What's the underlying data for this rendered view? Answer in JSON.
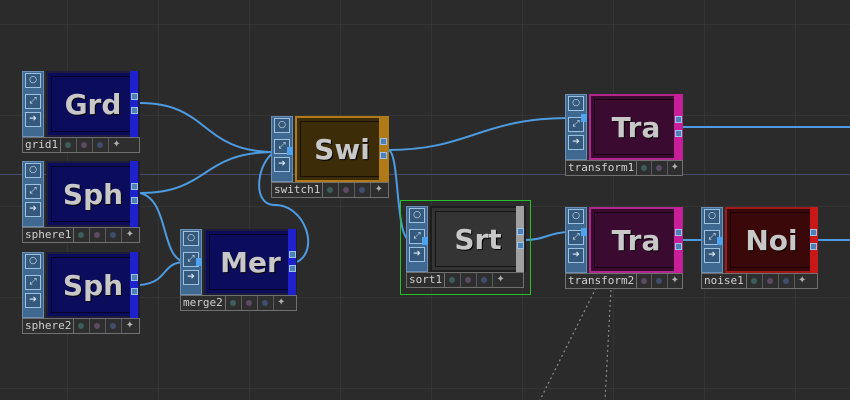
{
  "colors": {
    "background": "#2b2b2b",
    "wire": "#4d9be0",
    "top_tile": "#0c0c5c",
    "top_strip": "#1f22cc",
    "switch_tile": "#3c2c08",
    "switch_border": "#b07a18",
    "sort_tile": "#343434",
    "sort_strip": "#a0a0a0",
    "sort_highlight": "#27c227",
    "transform_tile": "#3a0a30",
    "transform_strip": "#c81e9a",
    "noise_tile": "#3a0808",
    "noise_strip": "#c81818"
  },
  "nodes": {
    "grid1": {
      "short": "Grd",
      "name": "grid1"
    },
    "sphere1": {
      "short": "Sph",
      "name": "sphere1"
    },
    "sphere2": {
      "short": "Sph",
      "name": "sphere2"
    },
    "merge2": {
      "short": "Mer",
      "name": "merge2"
    },
    "switch1": {
      "short": "Swi",
      "name": "switch1"
    },
    "sort1": {
      "short": "Srt",
      "name": "sort1"
    },
    "transform1": {
      "short": "Tra",
      "name": "transform1"
    },
    "transform2": {
      "short": "Tra",
      "name": "transform2"
    },
    "noise1": {
      "short": "Noi",
      "name": "noise1"
    }
  },
  "icons": {
    "flag_bypass": "bypass-flag-icon",
    "flag_lock": "lock-flag-icon",
    "flag_display": "display-flag-icon",
    "flag_render": "render-flag-icon",
    "viewer": "viewer-star-icon"
  }
}
